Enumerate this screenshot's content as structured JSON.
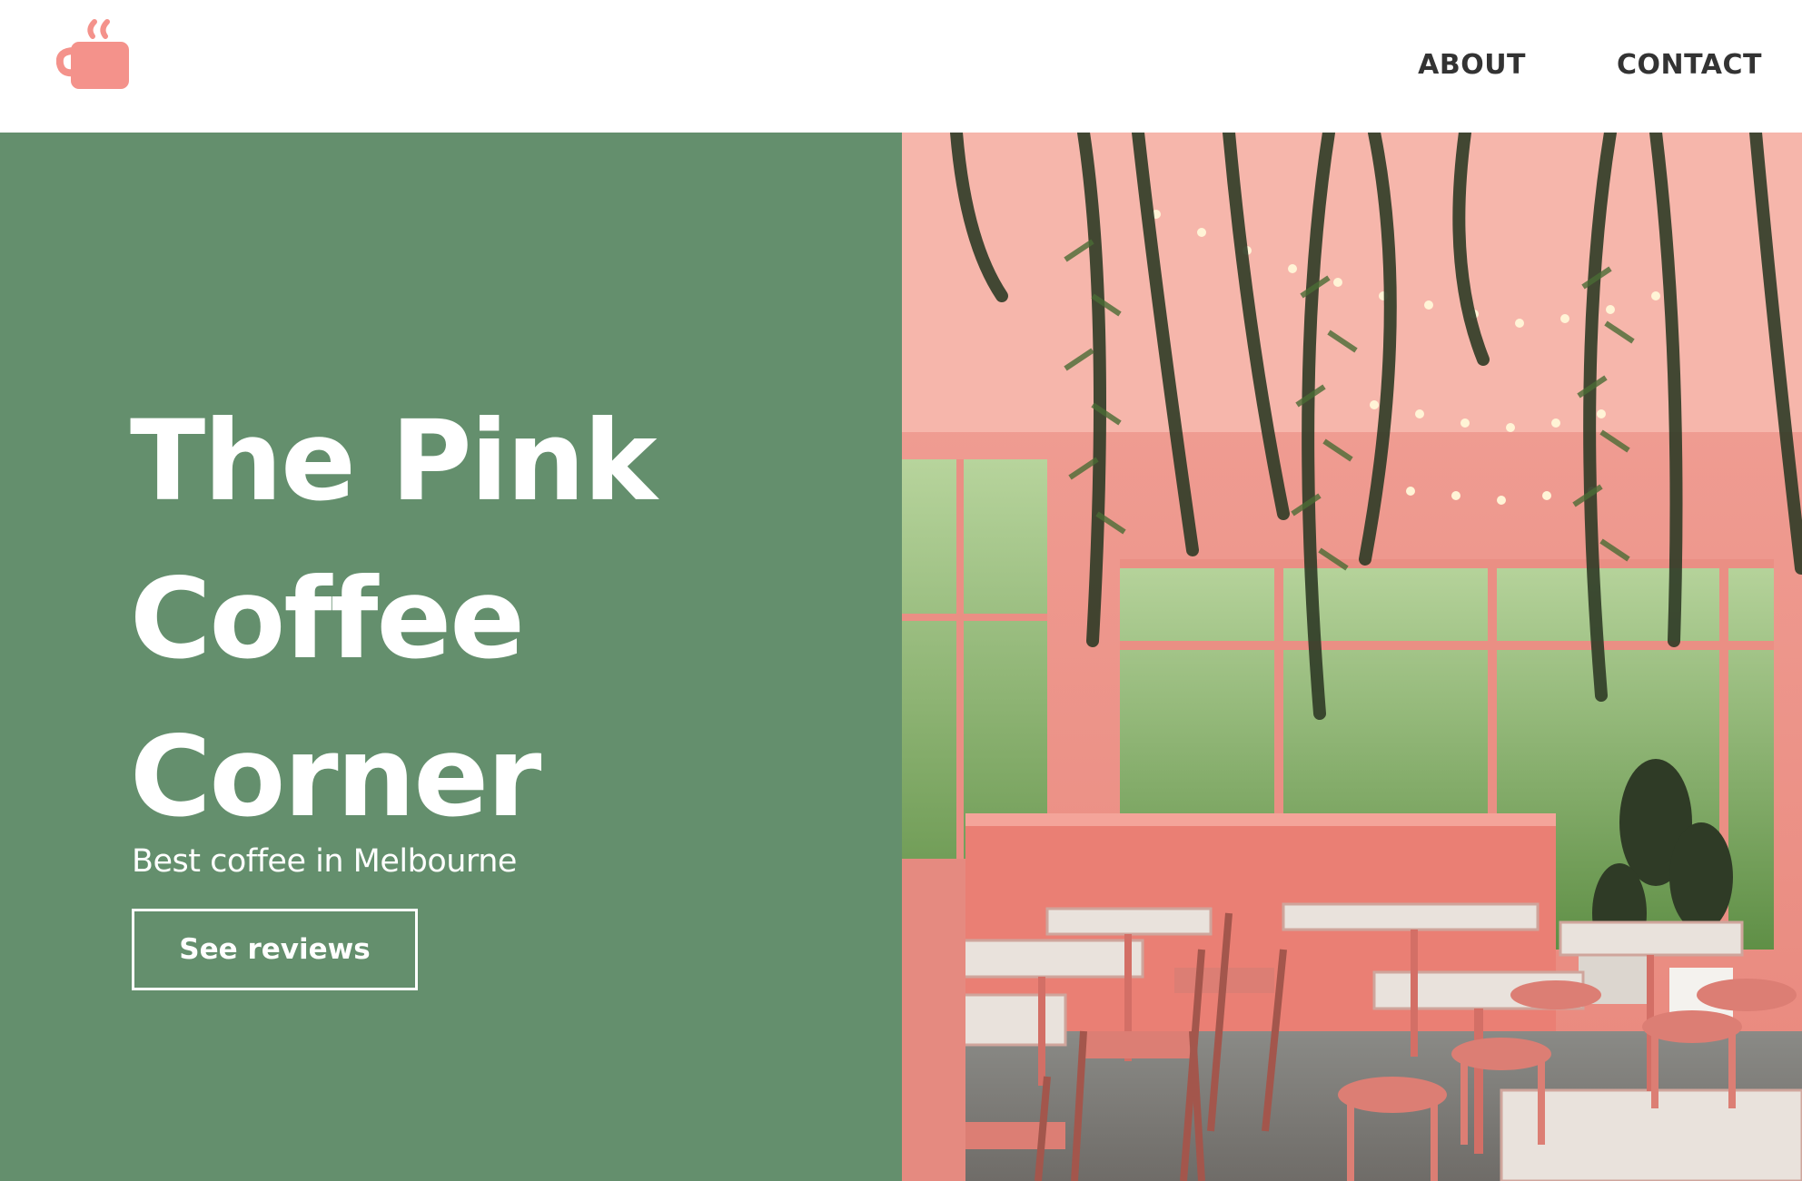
{
  "header": {
    "logo_icon": "coffee-cup-icon",
    "nav": [
      {
        "label": "ABOUT"
      },
      {
        "label": "CONTACT"
      }
    ]
  },
  "hero": {
    "title_lines": [
      "The Pink",
      "Coffee",
      "Corner"
    ],
    "tagline": "Best coffee in Melbourne",
    "cta_label": "See reviews",
    "background_color": "#648f6d",
    "photo_description_icon": "cafe-interior-photo"
  },
  "colors": {
    "accent": "#f4928b",
    "green": "#648f6d",
    "nav_text": "#333333"
  }
}
